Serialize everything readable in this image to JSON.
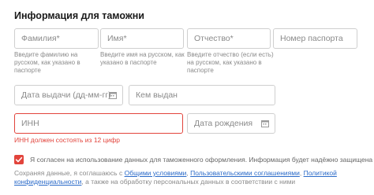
{
  "section": {
    "title": "Информация для таможни"
  },
  "fields": {
    "last_name": {
      "placeholder": "Фамилия*",
      "hint": "Введите фамилию на русском, как указано в паспорте"
    },
    "first_name": {
      "placeholder": "Имя*",
      "hint": "Введите имя на русском, как указано в паспорте"
    },
    "patronymic": {
      "placeholder": "Отчество*",
      "hint": "Введите отчество (если есть) на русском, как указано в паспорте"
    },
    "passport_number": {
      "placeholder": "Номер паспорта"
    },
    "issue_date": {
      "placeholder": "Дата выдачи (дд-мм-гг)"
    },
    "issued_by": {
      "placeholder": "Кем выдан"
    },
    "inn": {
      "placeholder": "ИНН",
      "error": "ИНН должен состоять из 12 цифр"
    },
    "birth_date": {
      "placeholder": "Дата рождения"
    }
  },
  "icons": {
    "calendar": "calendar-icon",
    "checkmark": "check-icon"
  },
  "colors": {
    "error": "#e2443c",
    "link": "#2a6ac8"
  },
  "consent": {
    "checked": true,
    "label": "Я согласен на использование данных для таможенного оформления. Информация будет надёжно защищена"
  },
  "legal": {
    "prefix": "Сохраняя данные, я соглашаюсь с ",
    "link_terms": "Общими условиями",
    "sep1": ", ",
    "link_user_agreements": "Пользовательскими соглашениями",
    "sep2": ", ",
    "link_privacy": "Политикой конфиденциальности",
    "suffix": ", а также на обработку персональных данных в соответствии с ними"
  }
}
